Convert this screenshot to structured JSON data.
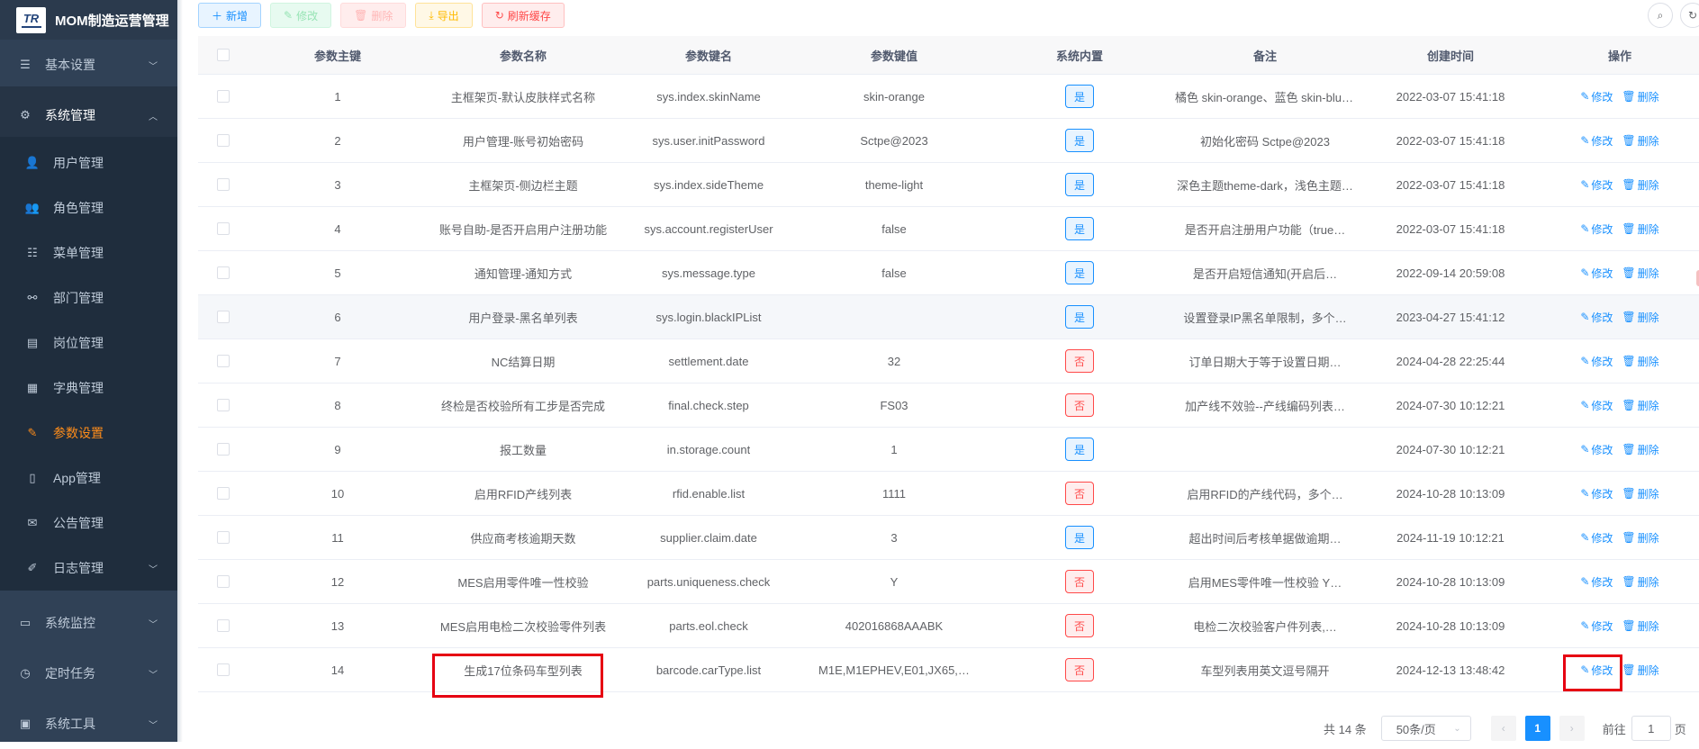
{
  "app": {
    "title": "MOM制造运营管理",
    "logo_text": "TR"
  },
  "sidebar": {
    "items": [
      {
        "label": "基本设置",
        "icon": "sliders-icon",
        "level": "top"
      },
      {
        "label": "系统管理",
        "icon": "gear-icon",
        "level": "top",
        "expanded": true
      },
      {
        "label": "用户管理",
        "icon": "user-icon",
        "level": "sub"
      },
      {
        "label": "角色管理",
        "icon": "users-icon",
        "level": "sub"
      },
      {
        "label": "菜单管理",
        "icon": "tree-list-icon",
        "level": "sub"
      },
      {
        "label": "部门管理",
        "icon": "org-chart-icon",
        "level": "sub"
      },
      {
        "label": "岗位管理",
        "icon": "post-icon",
        "level": "sub"
      },
      {
        "label": "字典管理",
        "icon": "dict-icon",
        "level": "sub"
      },
      {
        "label": "参数设置",
        "icon": "edit-icon",
        "level": "sub",
        "active": true
      },
      {
        "label": "App管理",
        "icon": "phone-icon",
        "level": "sub"
      },
      {
        "label": "公告管理",
        "icon": "message-icon",
        "level": "sub"
      },
      {
        "label": "日志管理",
        "icon": "log-icon",
        "level": "sub"
      },
      {
        "label": "系统监控",
        "icon": "monitor-icon",
        "level": "top"
      },
      {
        "label": "定时任务",
        "icon": "job-icon",
        "level": "top"
      },
      {
        "label": "系统工具",
        "icon": "toolbox-icon",
        "level": "top"
      }
    ]
  },
  "toolbar": {
    "add_label": "新增",
    "edit_label": "修改",
    "delete_label": "删除",
    "export_label": "导出",
    "refresh_label": "刷新缓存"
  },
  "table": {
    "columns": [
      "参数主键",
      "参数名称",
      "参数键名",
      "参数键值",
      "系统内置",
      "备注",
      "创建时间",
      "操作"
    ],
    "rows": [
      {
        "id": "1",
        "name": "主框架页-默认皮肤样式名称",
        "key": "sys.index.skinName",
        "value": "skin-orange",
        "builtin": "是",
        "remark": "橘色 skin-orange、蓝色 skin-blue、…",
        "time": "2022-03-07 15:41:18"
      },
      {
        "id": "2",
        "name": "用户管理-账号初始密码",
        "key": "sys.user.initPassword",
        "value": "Sctpe@2023",
        "builtin": "是",
        "remark": "初始化密码 Sctpe@2023",
        "time": "2022-03-07 15:41:18"
      },
      {
        "id": "3",
        "name": "主框架页-侧边栏主题",
        "key": "sys.index.sideTheme",
        "value": "theme-light",
        "builtin": "是",
        "remark": "深色主题theme-dark，浅色主题…",
        "time": "2022-03-07 15:41:18"
      },
      {
        "id": "4",
        "name": "账号自助-是否开启用户注册功能",
        "key": "sys.account.registerUser",
        "value": "false",
        "builtin": "是",
        "remark": "是否开启注册用户功能（true…",
        "time": "2022-03-07 15:41:18"
      },
      {
        "id": "5",
        "name": "通知管理-通知方式",
        "key": "sys.message.type",
        "value": "false",
        "builtin": "是",
        "remark": "是否开启短信通知(开启后…",
        "time": "2022-09-14 20:59:08"
      },
      {
        "id": "6",
        "name": "用户登录-黑名单列表",
        "key": "sys.login.blackIPList",
        "value": "",
        "builtin": "是",
        "remark": "设置登录IP黑名单限制，多个…",
        "time": "2023-04-27 15:41:12"
      },
      {
        "id": "7",
        "name": "NC结算日期",
        "key": "settlement.date",
        "value": "32",
        "builtin": "否",
        "remark": "订单日期大于等于设置日期…",
        "time": "2024-04-28 22:25:44"
      },
      {
        "id": "8",
        "name": "终检是否校验所有工步是否完成",
        "key": "final.check.step",
        "value": "FS03",
        "builtin": "否",
        "remark": "加产线不效验--产线编码列表…",
        "time": "2024-07-30 10:12:21"
      },
      {
        "id": "9",
        "name": "报工数量",
        "key": "in.storage.count",
        "value": "1",
        "builtin": "是",
        "remark": "",
        "time": "2024-07-30 10:12:21"
      },
      {
        "id": "10",
        "name": "启用RFID产线列表",
        "key": "rfid.enable.list",
        "value": "1111",
        "builtin": "否",
        "remark": "启用RFID的产线代码，多个…",
        "time": "2024-10-28 10:13:09"
      },
      {
        "id": "11",
        "name": "供应商考核逾期天数",
        "key": "supplier.claim.date",
        "value": "3",
        "builtin": "是",
        "remark": "超出时间后考核单据做逾期…",
        "time": "2024-11-19 10:12:21"
      },
      {
        "id": "12",
        "name": "MES启用零件唯一性校验",
        "key": "parts.uniqueness.check",
        "value": "Y",
        "builtin": "否",
        "remark": "启用MES零件唯一性校验 Y…",
        "time": "2024-10-28 10:13:09"
      },
      {
        "id": "13",
        "name": "MES启用电检二次校验零件列表",
        "key": "parts.eol.check",
        "value": "402016868AAABK",
        "builtin": "否",
        "remark": "电检二次校验客户件列表,…",
        "time": "2024-10-28 10:13:09"
      },
      {
        "id": "14",
        "name": "生成17位条码车型列表",
        "key": "barcode.carType.list",
        "value": "M1E,M1EPHEV,E01,JX65,…",
        "builtin": "否",
        "remark": "车型列表用英文逗号隔开",
        "time": "2024-12-13 13:48:42"
      }
    ],
    "op_edit": "修改",
    "op_delete": "删除"
  },
  "pagination": {
    "total_text": "共 14 条",
    "page_size": "50条/页",
    "current_page": "1",
    "goto_label": "前往",
    "goto_value": "1",
    "page_suffix": "页"
  },
  "colors": {
    "sidebar_bg": "#304156",
    "active": "#ff8d1a",
    "primary": "#1890ff",
    "danger": "#ff4949",
    "highlight_box": "#e60012"
  }
}
